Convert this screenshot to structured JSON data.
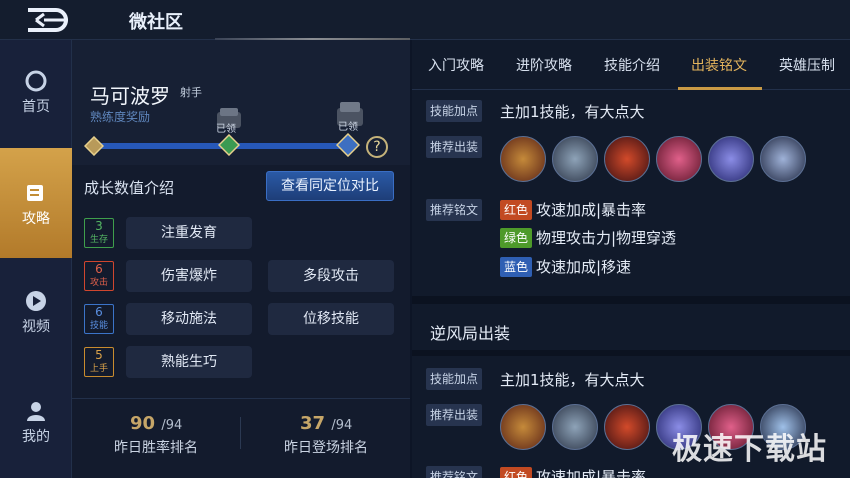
{
  "header": {
    "title": "微社区"
  },
  "sidebar": {
    "items": [
      {
        "label": "首页",
        "icon": "home-icon"
      },
      {
        "label": "攻略",
        "icon": "guide-icon"
      },
      {
        "label": "视频",
        "icon": "video-icon"
      },
      {
        "label": "我的",
        "icon": "user-icon"
      }
    ]
  },
  "hero": {
    "name": "马可波罗",
    "role": "射手",
    "reward_label": "熟练度奖励",
    "milestone_labels": [
      "已领",
      "已领"
    ],
    "help_label": "?"
  },
  "growth": {
    "title": "成长数值介绍",
    "compare_button": "查看同定位对比",
    "rows": [
      {
        "score": "3",
        "score_label": "生存",
        "color": "#3f9f4c",
        "items": [
          "注重发育"
        ]
      },
      {
        "score": "6",
        "score_label": "攻击",
        "color": "#d0462e",
        "items": [
          "伤害爆炸",
          "多段攻击"
        ]
      },
      {
        "score": "6",
        "score_label": "技能",
        "color": "#3b74c9",
        "items": [
          "移动施法",
          "位移技能"
        ]
      },
      {
        "score": "5",
        "score_label": "上手",
        "color": "#c98c2e",
        "items": [
          "熟能生巧"
        ]
      }
    ]
  },
  "stats": [
    {
      "value": "90",
      "total": "/94",
      "label": "昨日胜率排名"
    },
    {
      "value": "37",
      "total": "/94",
      "label": "昨日登场排名"
    }
  ],
  "tabs": [
    "入门攻略",
    "进阶攻略",
    "技能介绍",
    "出装铭文",
    "英雄压制"
  ],
  "active_tab": "出装铭文",
  "build_main": {
    "skill_label": "技能加点",
    "skill_text": "主加1技能，有大点大",
    "items_label": "推荐出装",
    "runes_label": "推荐铭文",
    "runes": [
      {
        "color_name": "红色",
        "color": "#c24a22",
        "text": "攻速加成|暴击率"
      },
      {
        "color_name": "绿色",
        "color": "#4e9a2a",
        "text": "物理攻击力|物理穿透"
      },
      {
        "color_name": "蓝色",
        "color": "#2f5fb3",
        "text": "攻速加成|移速"
      }
    ]
  },
  "build_alt": {
    "title": "逆风局出装",
    "skill_label": "技能加点",
    "skill_text": "主加1技能，有大点大",
    "items_label": "推荐出装",
    "runes_label": "推荐铭文",
    "rune_partial": {
      "color_name": "红色",
      "text": "攻速加成|暴击率"
    }
  },
  "watermark": "极速下载站"
}
